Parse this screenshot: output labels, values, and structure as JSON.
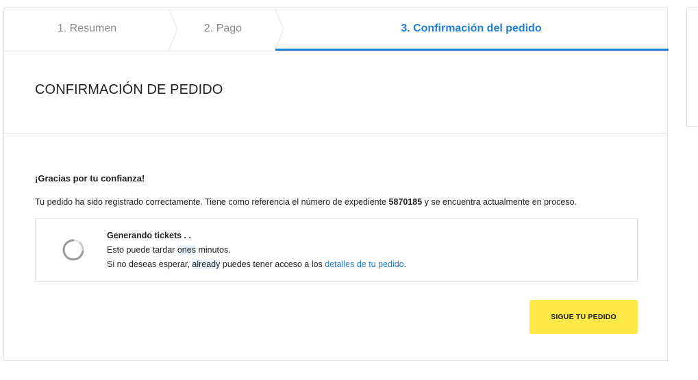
{
  "steps": [
    {
      "label": "1. Resumen",
      "active": false
    },
    {
      "label": "2. Pago",
      "active": false
    },
    {
      "label": "3. Confirmación del pedido",
      "active": true
    }
  ],
  "colors": {
    "accent": "#1b7fd6",
    "button": "#fde84a",
    "border": "#e3e3e3",
    "muted": "#8a8a8a"
  },
  "page": {
    "title": "CONFIRMACIÓN DE PEDIDO"
  },
  "confirmation": {
    "thanks": "¡Gracias por tu confianza!",
    "registered_prefix": "Tu pedido ha sido registrado correctamente. Tiene como referencia el número de expediente ",
    "file_number": "5870185",
    "registered_suffix": " y se encuentra actualmente en proceso."
  },
  "tickets": {
    "spinner_icon": "loading-spinner-icon",
    "title": "Generando tickets . .",
    "line1_prefix": "Esto puede tardar ",
    "line1_highlight": "ones",
    "line1_suffix": " minutos.",
    "line2_prefix": "Si no deseas esperar, ",
    "line2_highlight": "already",
    "line2_middle": " puedes tener acceso a los ",
    "line2_link": "detalles de tu pedido",
    "line2_suffix": "."
  },
  "actions": {
    "track_button": "SIGUE TU PEDIDO"
  }
}
